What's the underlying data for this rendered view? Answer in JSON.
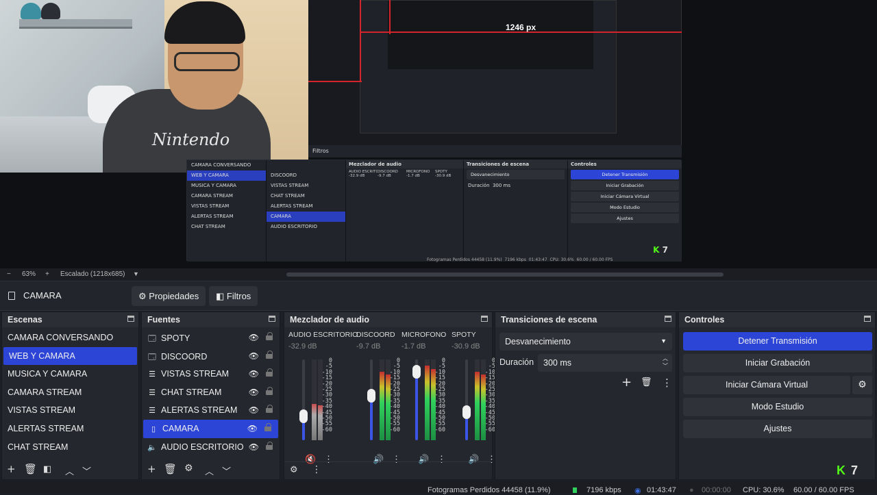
{
  "preview": {
    "nested_px_label": "1246 px",
    "nested_filters_tab": "Filtros",
    "mini_scenes": [
      "CAMARA CONVERSANDO",
      "WEB Y CAMARA",
      "MUSICA Y CAMARA",
      "CAMARA STREAM",
      "VISTAS STREAM",
      "ALERTAS STREAM",
      "CHAT STREAM"
    ],
    "mini_sources": [
      "DISCOORD",
      "VISTAS STREAM",
      "CHAT STREAM",
      "ALERTAS STREAM",
      "CAMARA",
      "AUDIO ESCRITORIO"
    ],
    "mini_mixer_title": "Mezclador de audio",
    "mini_transitions_title": "Transiciones de escena",
    "mini_controls_title": "Controles",
    "mini_controls": [
      "Detener Transmisión",
      "Iniciar Grabación",
      "Iniciar Cámara Virtual",
      "Modo Estudio",
      "Ajustes"
    ],
    "mini_transition": "Desvanecimiento",
    "mini_duration_label": "Duración",
    "mini_duration": "300 ms",
    "mini_channels": [
      "AUDIO ESCRITORIO",
      "DISCOORD",
      "MICROFONO",
      "SPOTY"
    ],
    "mini_dbs": [
      "-32.9 dB",
      "-9.7 dB",
      "-1.7 dB",
      "-30.9 dB"
    ],
    "mini_status": "Fotogramas Perdidos 44458 (11.9%)",
    "mini_kbps": "7196 kbps",
    "mini_time": "01:43:47",
    "mini_cpu": "CPU: 30.6%",
    "mini_fps": "60.00 / 60.00 FPS",
    "mini_kick": "7"
  },
  "zoom": {
    "minus": "−",
    "percent": "63%",
    "plus": "+",
    "scaling": "Escalado (1218x685)",
    "dropdown": "▼"
  },
  "source_toolbar": {
    "source_name": "CAMARA",
    "properties_label": "Propiedades",
    "filters_label": "Filtros"
  },
  "scenes": {
    "title": "Escenas",
    "items": [
      "CAMARA CONVERSANDO",
      "WEB Y CAMARA",
      "MUSICA Y CAMARA",
      "CAMARA STREAM",
      "VISTAS STREAM",
      "ALERTAS STREAM",
      "CHAT STREAM"
    ],
    "selected_index": 1
  },
  "sources": {
    "title": "Fuentes",
    "items": [
      {
        "label": "SPOTY",
        "icon": "window-capture-icon"
      },
      {
        "label": "DISCOORD",
        "icon": "window-capture-icon"
      },
      {
        "label": "VISTAS STREAM",
        "icon": "browser-source-icon"
      },
      {
        "label": "CHAT STREAM",
        "icon": "browser-source-icon"
      },
      {
        "label": "ALERTAS STREAM",
        "icon": "browser-source-icon"
      },
      {
        "label": "CAMARA",
        "icon": "image-source-icon"
      },
      {
        "label": "AUDIO ESCRITORIO",
        "icon": "speaker-icon"
      }
    ],
    "selected_index": 5
  },
  "mixer": {
    "title": "Mezclador de audio",
    "channels": [
      {
        "name": "AUDIO ESCRITORIO",
        "db": "-32.9 dB",
        "fader": 0.3,
        "level": 0.45,
        "muted": true
      },
      {
        "name": "DISCOORD",
        "db": "-9.7 dB",
        "fader": 0.55,
        "level": 0.85,
        "muted": false
      },
      {
        "name": "MICROFONO",
        "db": "-1.7 dB",
        "fader": 0.85,
        "level": 0.92,
        "muted": false
      },
      {
        "name": "SPOTY",
        "db": "-30.9 dB",
        "fader": 0.35,
        "level": 0.85,
        "muted": false
      }
    ],
    "scale": [
      "0",
      "-5",
      "-10",
      "-15",
      "-20",
      "-25",
      "-30",
      "-35",
      "-40",
      "-45",
      "-50",
      "-55",
      "-60"
    ]
  },
  "transitions": {
    "title": "Transiciones de escena",
    "selected": "Desvanecimiento",
    "duration_label": "Duración",
    "duration_value": "300 ms"
  },
  "controls": {
    "title": "Controles",
    "stop_stream": "Detener Transmisión",
    "start_recording": "Iniciar Grabación",
    "start_virtual_cam": "Iniciar Cámara Virtual",
    "studio_mode": "Modo Estudio",
    "settings": "Ajustes"
  },
  "status": {
    "dropped_frames": "Fotogramas Perdidos 44458 (11.9%)",
    "kbps": "7196 kbps",
    "stream_time": "01:43:47",
    "rec_time": "00:00:00",
    "cpu": "CPU: 30.6%",
    "fps": "60.00 / 60.00 FPS"
  },
  "kick_badge": {
    "count": "7"
  },
  "colors": {
    "accent": "#2c45d6",
    "kick_green": "#53fc18",
    "live_red": "#d6242d"
  }
}
